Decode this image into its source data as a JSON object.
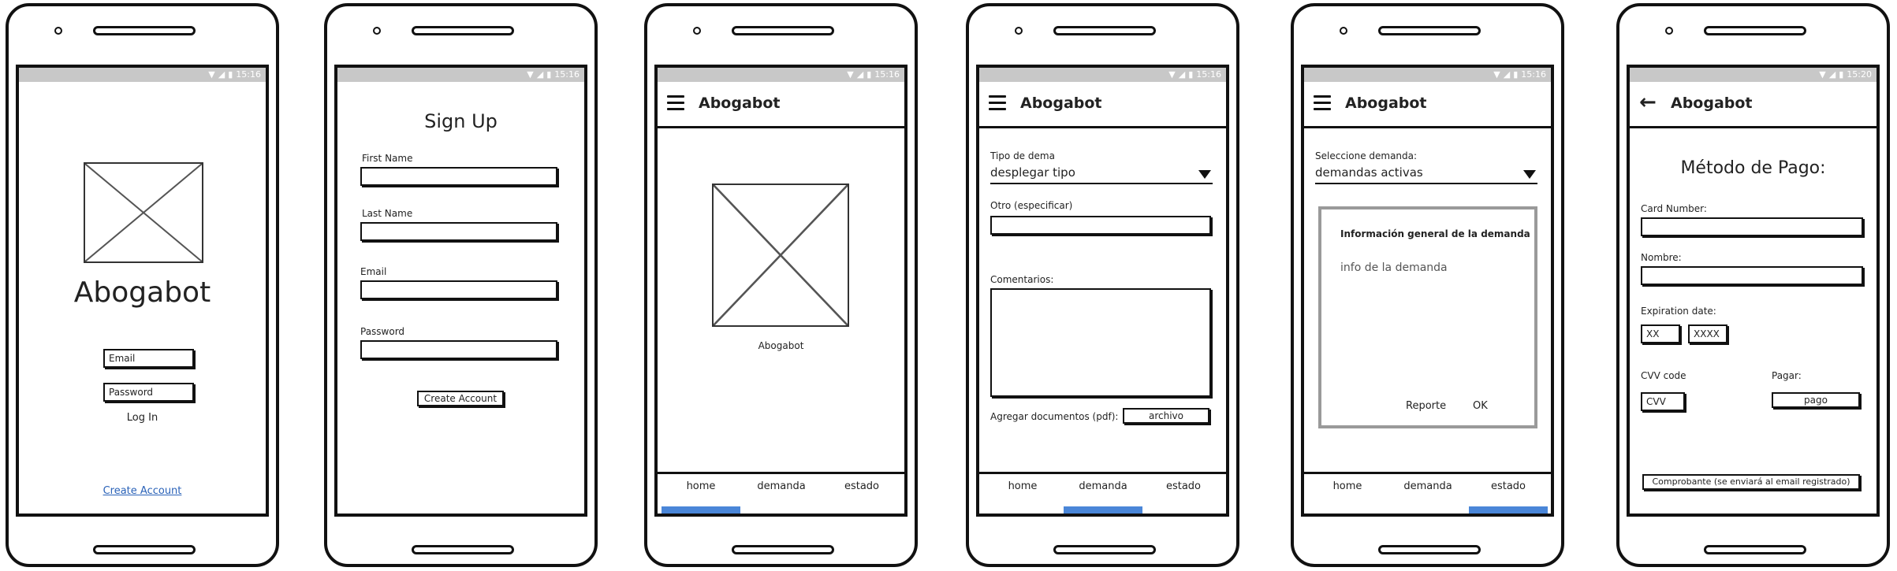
{
  "status": {
    "time_a": "15:16",
    "time_b": "15:20"
  },
  "icons": {
    "wifi": "wifi-icon",
    "signal": "signal-icon",
    "battery": "battery-icon",
    "menu": "menu-icon",
    "back": "back-arrow-icon",
    "image": "image-placeholder-icon",
    "dropdown": "dropdown-arrow-icon"
  },
  "colors": {
    "status_bar": "#c8c8c8",
    "tab_indicator": "#4a86d8",
    "link": "#2a62b8"
  },
  "login": {
    "app_name": "Abogabot",
    "email_placeholder": "Email",
    "password_placeholder": "Password",
    "login_label": "Log In",
    "create_account_link": "Create Account"
  },
  "signup": {
    "title": "Sign Up",
    "first_name_label": "First Name",
    "last_name_label": "Last Name",
    "email_label": "Email",
    "password_label": "Password",
    "create_button": "Create Account"
  },
  "home": {
    "app_title": "Abogabot",
    "logo_caption": "Abogabot"
  },
  "tabs": {
    "home": "home",
    "demanda": "demanda",
    "estado": "estado"
  },
  "demanda": {
    "app_title": "Abogabot",
    "tipo_label": "Tipo de dema",
    "tipo_value": "desplegar tipo",
    "otro_label": "Otro (especificar)",
    "comentarios_label": "Comentarios:",
    "documentos_label": "Agregar documentos (pdf):",
    "archivo_button": "archivo"
  },
  "estado": {
    "app_title": "Abogabot",
    "select_label": "Seleccione demanda:",
    "select_value": "demandas activas",
    "panel_title": "Información general de la demanda",
    "panel_info": "info de la demanda",
    "reporte_button": "Reporte",
    "ok_button": "OK"
  },
  "pago": {
    "app_title": "Abogabot",
    "title": "Método de Pago:",
    "card_label": "Card Number:",
    "nombre_label": "Nombre:",
    "expiration_label": "Expiration date:",
    "exp_month_placeholder": "XX",
    "exp_year_placeholder": "XXXX",
    "cvv_label": "CVV code",
    "cvv_placeholder": "CVV",
    "pagar_label": "Pagar:",
    "pago_button": "pago",
    "comprobante_button": "Comprobante (se enviará al email registrado)"
  }
}
